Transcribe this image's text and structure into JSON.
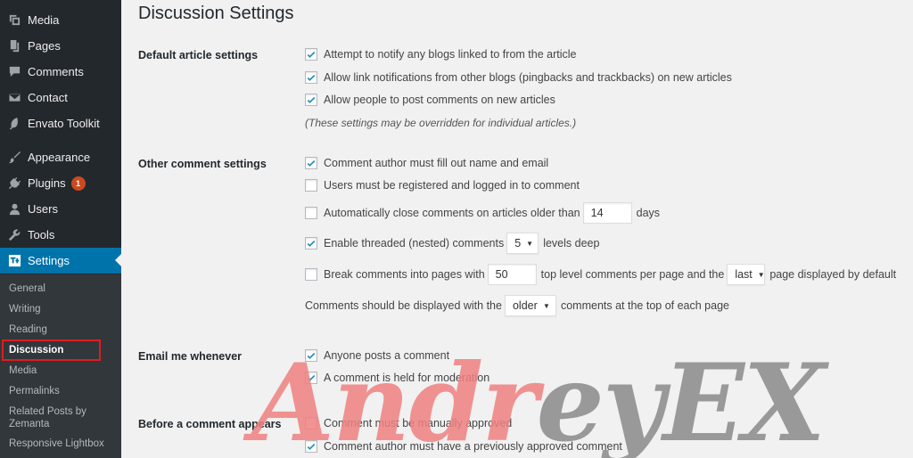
{
  "sidebar": {
    "items": [
      {
        "label": "Media",
        "icon": "media-icon",
        "badge": ""
      },
      {
        "label": "Pages",
        "icon": "pages-icon",
        "badge": ""
      },
      {
        "label": "Comments",
        "icon": "comments-icon",
        "badge": ""
      },
      {
        "label": "Contact",
        "icon": "mail-icon",
        "badge": ""
      },
      {
        "label": "Envato Toolkit",
        "icon": "envato-leaf-icon",
        "badge": ""
      },
      {
        "label": "Appearance",
        "icon": "paintbrush-icon",
        "badge": ""
      },
      {
        "label": "Plugins",
        "icon": "plug-icon",
        "badge": "1"
      },
      {
        "label": "Users",
        "icon": "users-icon",
        "badge": ""
      },
      {
        "label": "Tools",
        "icon": "wrench-icon",
        "badge": ""
      },
      {
        "label": "Settings",
        "icon": "settings-icon",
        "badge": ""
      }
    ],
    "submenu": [
      "General",
      "Writing",
      "Reading",
      "Discussion",
      "Media",
      "Permalinks",
      "Related Posts by",
      "Zemanta",
      "Responsive Lightbox"
    ]
  },
  "page": {
    "title": "Discussion Settings"
  },
  "default_article": {
    "label": "Default article settings",
    "opt1": "Attempt to notify any blogs linked to from the article",
    "opt2": "Allow link notifications from other blogs (pingbacks and trackbacks) on new articles",
    "opt3": "Allow people to post comments on new articles",
    "note": "(These settings may be overridden for individual articles.)"
  },
  "other_comment": {
    "label": "Other comment settings",
    "opt1": "Comment author must fill out name and email",
    "opt2": "Users must be registered and logged in to comment",
    "opt3_pre": "Automatically close comments on articles older than",
    "opt3_value": "14",
    "opt3_post": "days",
    "opt4_pre": "Enable threaded (nested) comments",
    "opt4_value": "5",
    "opt4_post": "levels deep",
    "opt5_pre": "Break comments into pages with",
    "opt5_value": "50",
    "opt5_mid": "top level comments per page and the",
    "opt5_select": "last",
    "opt5_post": "page displayed by default",
    "opt6_pre": "Comments should be displayed with the",
    "opt6_select": "older",
    "opt6_post": "comments at the top of each page"
  },
  "email": {
    "label": "Email me whenever",
    "opt1": "Anyone posts a comment",
    "opt2": "A comment is held for moderation"
  },
  "before_comment": {
    "label": "Before a comment appears",
    "opt1": "Comment must be manually approved",
    "opt2": "Comment author must have a previously approved comment"
  },
  "watermark": {
    "text_red": "Andr",
    "text_gray": "eyEX",
    "color_red": "#f08080",
    "color_gray": "#8a8a8a"
  },
  "colors": {
    "sidebar_bg": "#23282d",
    "submenu_bg": "#32373c",
    "active_bg": "#0073aa",
    "checkmark": "#1e8cbe",
    "highlight_border": "#e01d1d",
    "badge_bg": "#ca4a1f"
  }
}
